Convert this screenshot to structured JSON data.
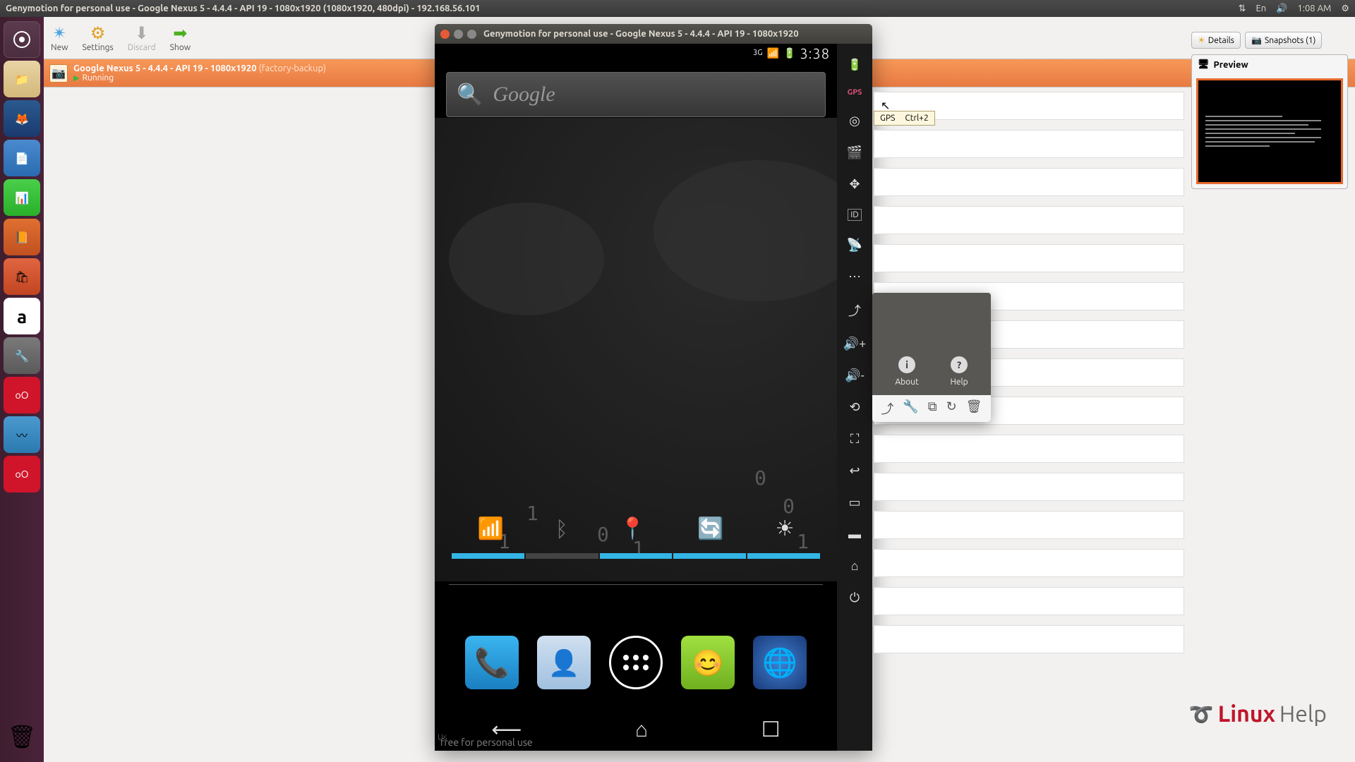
{
  "topbar": {
    "title": "Genymotion for personal use - Google Nexus 5 - 4.4.4 - API 19 - 1080x1920 (1080x1920, 480dpi) - 192.168.56.101",
    "lang": "En",
    "time": "1:08 AM"
  },
  "toolbar": {
    "new": "New",
    "settings": "Settings",
    "discard": "Discard",
    "show": "Show"
  },
  "device": {
    "title": "Google Nexus 5 - 4.4.4 - API 19 - 1080x1920",
    "backup_label": "(factory-backup)",
    "status": "Running"
  },
  "right": {
    "details": "Details",
    "snapshots": "Snapshots (1)",
    "preview": "Preview"
  },
  "emulator": {
    "window_title": "Genymotion for personal use - Google Nexus 5 - 4.4.4 - API 19 - 1080x1920",
    "status": {
      "signal": "3G",
      "clock": "3:38"
    },
    "search_placeholder": "Google",
    "free_text": "free for personal use"
  },
  "tooltip": {
    "label": "GPS",
    "shortcut": "Ctrl+2"
  },
  "popup": {
    "about": "About",
    "help": "Help"
  },
  "bottom_hint": "Us",
  "watermark": {
    "brand1": "Linux",
    "brand2": "Help"
  }
}
